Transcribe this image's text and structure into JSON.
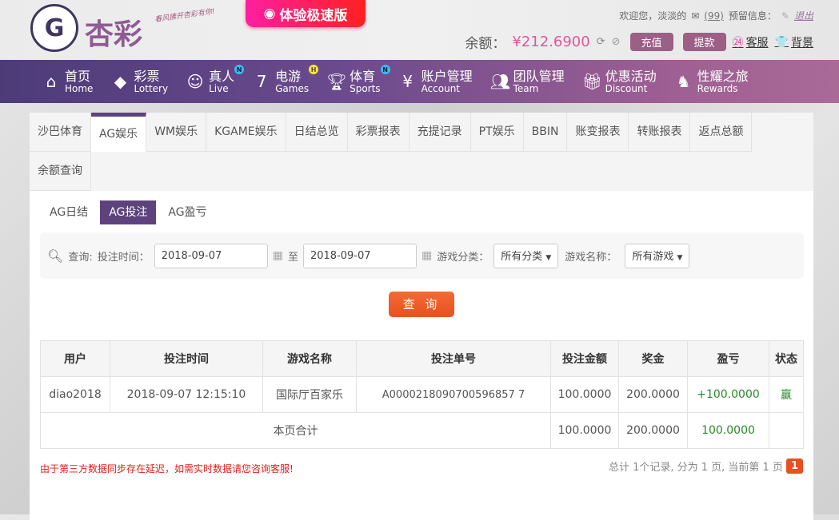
{
  "header": {
    "logo_text": "杏彩",
    "slogan": "春风拂开杏彩有你!",
    "speed_label": "体验极速版",
    "welcome": "欢迎您，淡淡的",
    "messages": "(99)",
    "reserved": "预留信息：",
    "logout": "退出",
    "balance_label": "余额：",
    "balance": "¥212.6900",
    "deposit": "充值",
    "withdraw": "提款",
    "service": "客服",
    "background": "背景"
  },
  "nav": [
    {
      "cn": "首页",
      "en": "Home",
      "icon": "home-icon"
    },
    {
      "cn": "彩票",
      "en": "Lottery",
      "icon": "ticket-icon"
    },
    {
      "cn": "真人",
      "en": "Live",
      "icon": "woman-icon",
      "badge": "N"
    },
    {
      "cn": "电游",
      "en": "Games",
      "icon": "seven-icon",
      "badge": "H"
    },
    {
      "cn": "体育",
      "en": "Sports",
      "icon": "trophy-icon",
      "badge": "N"
    },
    {
      "cn": "账户管理",
      "en": "Account",
      "icon": "yen-icon"
    },
    {
      "cn": "团队管理",
      "en": "Team",
      "icon": "team-icon"
    },
    {
      "cn": "优惠活动",
      "en": "Discount",
      "icon": "gift-icon"
    },
    {
      "cn": "性耀之旅",
      "en": "Rewards",
      "icon": "rewards-icon"
    }
  ],
  "tabs": [
    "沙巴体育",
    "AG娱乐",
    "WM娱乐",
    "KGAME娱乐",
    "日结总览",
    "彩票报表",
    "充提记录",
    "PT娱乐",
    "BBIN",
    "账变报表",
    "转账报表",
    "返点总额",
    "余额查询"
  ],
  "active_tab": "AG娱乐",
  "subtabs": [
    "AG日结",
    "AG投注",
    "AG盈亏"
  ],
  "active_subtab": "AG投注",
  "filter": {
    "query": "查询:",
    "time_label": "投注时间：",
    "start": "2018-09-07",
    "to": "至",
    "end": "2018-09-07",
    "category_label": "游戏分类：",
    "category": "所有分类",
    "game_label": "游戏名称：",
    "game": "所有游戏",
    "submit": "查 询"
  },
  "table": {
    "headers": [
      "用户",
      "投注时间",
      "游戏名称",
      "投注单号",
      "投注金额",
      "奖金",
      "盈亏",
      "状态"
    ],
    "rows": [
      [
        "diao2018",
        "2018-09-07 12:15:10",
        "国际厅百家乐",
        "A0000218090700596857 7",
        "100.0000",
        "200.0000",
        "+100.0000",
        "赢"
      ]
    ],
    "total": {
      "label": "本页合计",
      "bet": "100.0000",
      "prize": "200.0000",
      "profit": "100.0000"
    }
  },
  "notice": "由于第三方数据同步存在延迟，如需实时数据请您咨询客服!",
  "pager": {
    "summary": "总计 1个记录, 分为 1 页, 当前第 1 页",
    "current": "1"
  },
  "colors": {
    "nav_start": "#4d3b78",
    "nav_end": "#a96a98",
    "accent": "#5e427e",
    "button": "#e85020",
    "profit": "#2a8a2a"
  }
}
